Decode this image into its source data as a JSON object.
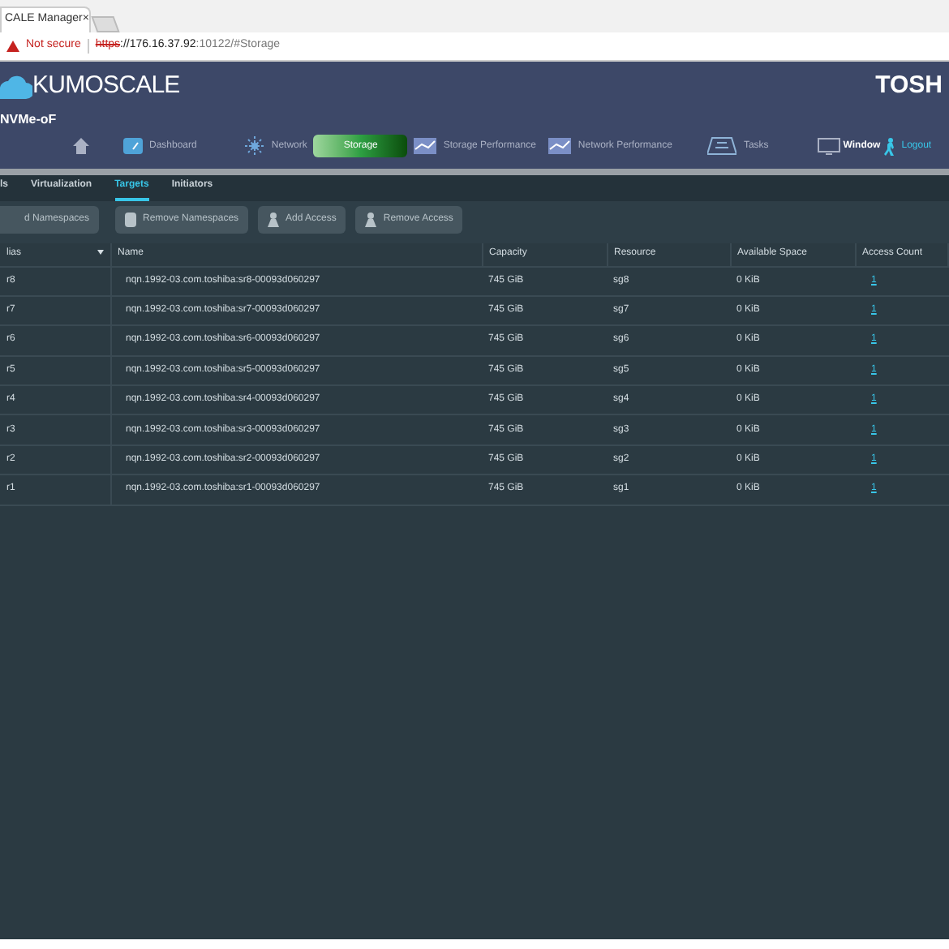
{
  "browser": {
    "tab_title": "CALE Manager",
    "tab_close": "×",
    "security": "Not secure",
    "url_scheme": "https",
    "url_host": "://176.16.37.92",
    "url_rest": ":10122/#Storage"
  },
  "header": {
    "logo": "KUMOSCALE",
    "brand": "TOSH",
    "subtitle": "NVMe-oF"
  },
  "nav": [
    {
      "kind": "home",
      "selected": false
    },
    {
      "label": "Dashboard",
      "kind": "dashboard",
      "selected": false
    },
    {
      "label": "Network",
      "kind": "network",
      "selected": false
    },
    {
      "label": "Storage",
      "kind": "storage",
      "selected": true
    },
    {
      "label": "Storage Performance",
      "kind": "chart",
      "selected": false
    },
    {
      "label": "Network Performance",
      "kind": "chart",
      "selected": false
    },
    {
      "label": "Tasks",
      "kind": "tasks",
      "selected": false
    }
  ],
  "window_link": "Window",
  "logout": "Logout",
  "tabs": [
    {
      "label": "ls",
      "selected": false
    },
    {
      "label": "Virtualization",
      "selected": false
    },
    {
      "label": "Targets",
      "selected": true
    },
    {
      "label": "Initiators",
      "selected": false
    }
  ],
  "actions": [
    {
      "label": "d Namespaces",
      "kind": "none"
    },
    {
      "label": "Remove Namespaces",
      "kind": "disk"
    },
    {
      "label": "Add Access",
      "kind": "person"
    },
    {
      "label": "Remove Access",
      "kind": "person"
    }
  ],
  "table": {
    "columns": [
      "lias",
      "Name",
      "Capacity",
      "Resource",
      "Available Space",
      "Access Count"
    ],
    "rows": [
      [
        "r8",
        "nqn.1992-03.com.toshiba:sr8-00093d060297",
        "745 GiB",
        "sg8",
        "0 KiB",
        "1"
      ],
      [
        "r7",
        "nqn.1992-03.com.toshiba:sr7-00093d060297",
        "745 GiB",
        "sg7",
        "0 KiB",
        "1"
      ],
      [
        "r6",
        "nqn.1992-03.com.toshiba:sr6-00093d060297",
        "745 GiB",
        "sg6",
        "0 KiB",
        "1"
      ],
      [
        "r5",
        "nqn.1992-03.com.toshiba:sr5-00093d060297",
        "745 GiB",
        "sg5",
        "0 KiB",
        "1"
      ],
      [
        "r4",
        "nqn.1992-03.com.toshiba:sr4-00093d060297",
        "745 GiB",
        "sg4",
        "0 KiB",
        "1"
      ],
      [
        "r3",
        "nqn.1992-03.com.toshiba:sr3-00093d060297",
        "745 GiB",
        "sg3",
        "0 KiB",
        "1"
      ],
      [
        "r2",
        "nqn.1992-03.com.toshiba:sr2-00093d060297",
        "745 GiB",
        "sg2",
        "0 KiB",
        "1"
      ],
      [
        "r1",
        "nqn.1992-03.com.toshiba:sr1-00093d060297",
        "745 GiB",
        "sg1",
        "0 KiB",
        "1"
      ]
    ]
  }
}
